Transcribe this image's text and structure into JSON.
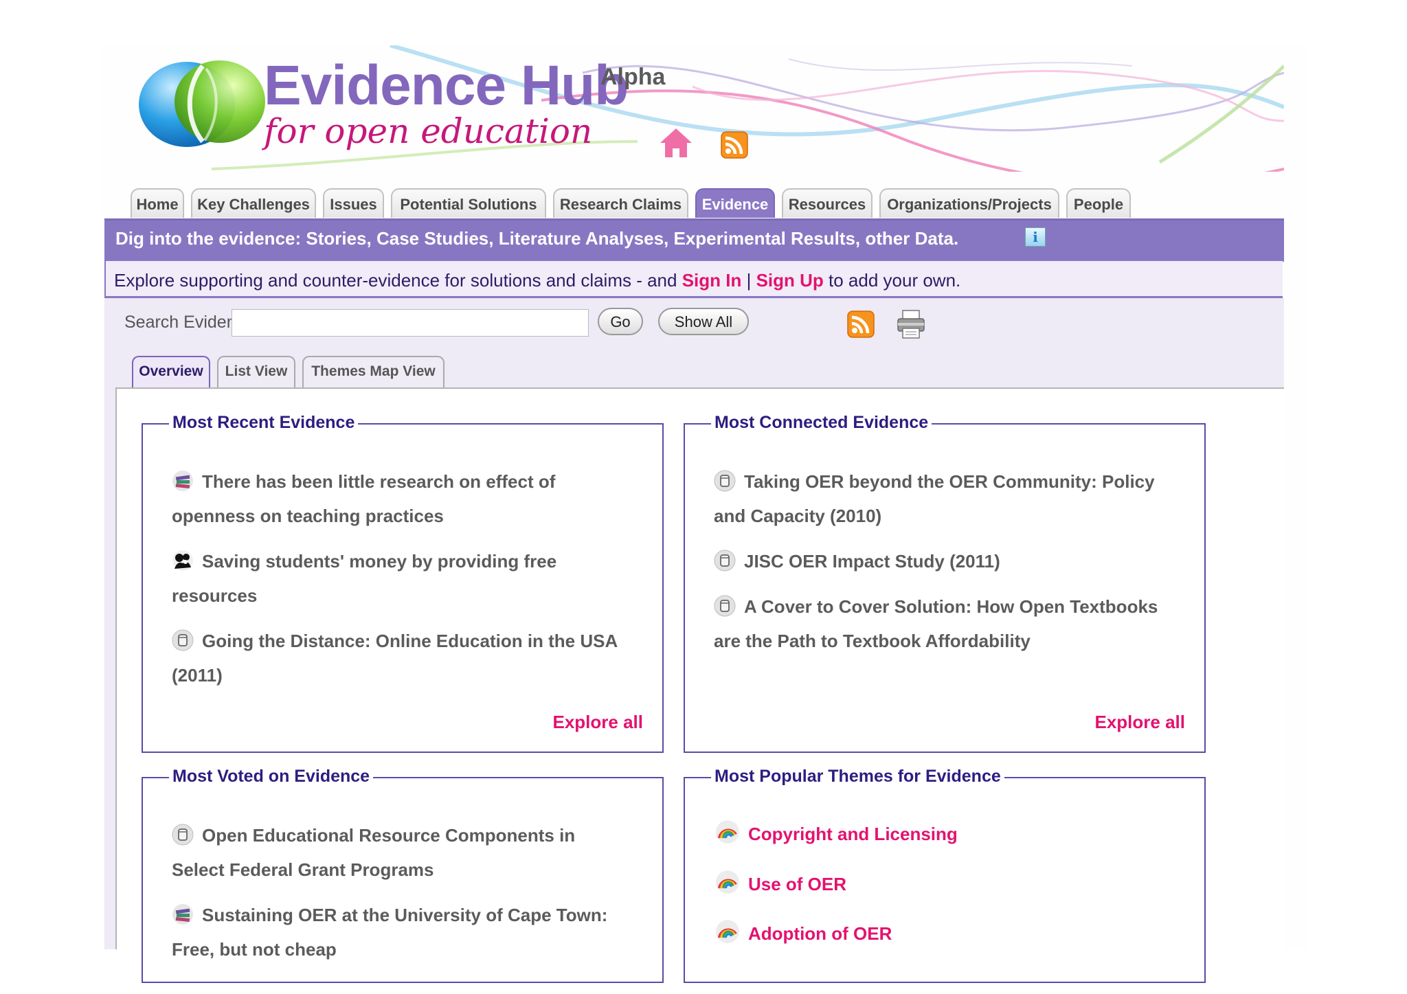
{
  "header": {
    "logo_title": "Evidence Hub",
    "logo_subtitle": "for open education",
    "badge": "Alpha",
    "home_icon": "home-icon",
    "rss_icon": "rss-icon"
  },
  "nav": {
    "tabs": [
      {
        "label": "Home",
        "active": false
      },
      {
        "label": "Key Challenges",
        "active": false
      },
      {
        "label": "Issues",
        "active": false
      },
      {
        "label": "Potential Solutions",
        "active": false
      },
      {
        "label": "Research Claims",
        "active": false
      },
      {
        "label": "Evidence",
        "active": true
      },
      {
        "label": "Resources",
        "active": false
      },
      {
        "label": "Organizations/Projects",
        "active": false
      },
      {
        "label": "People",
        "active": false
      }
    ]
  },
  "banner": {
    "heading": "Dig into the evidence: Stories, Case Studies, Literature Analyses, Experimental Results, other Data.",
    "info_icon_glyph": "i",
    "intro_before": "Explore supporting and counter-evidence for solutions and claims - and ",
    "sign_in": "Sign In",
    "separator": " | ",
    "sign_up": "Sign Up",
    "intro_after": " to add your own."
  },
  "search": {
    "label": "Search Evidence",
    "value": "",
    "go_label": "Go",
    "show_all_label": "Show All"
  },
  "view_tabs": [
    {
      "label": "Overview",
      "active": true
    },
    {
      "label": "List View",
      "active": false
    },
    {
      "label": "Themes Map View",
      "active": false
    }
  ],
  "panels": {
    "recent": {
      "title": "Most Recent Evidence",
      "items": [
        {
          "icon": "books-icon",
          "text": "There has been little research on effect of openness on teaching practices"
        },
        {
          "icon": "people-icon",
          "text": "Saving students' money by providing free resources"
        },
        {
          "icon": "database-icon",
          "text": "Going the Distance: Online Education in the USA (2011)"
        }
      ],
      "explore_all": "Explore all"
    },
    "connected": {
      "title": "Most Connected Evidence",
      "items": [
        {
          "icon": "database-icon",
          "text": "Taking OER beyond the OER Community: Policy and Capacity (2010)"
        },
        {
          "icon": "database-icon",
          "text": "JISC OER Impact Study (2011)"
        },
        {
          "icon": "database-icon",
          "text": "A Cover to Cover Solution: How Open Textbooks are the Path to Textbook Affordability"
        }
      ],
      "explore_all": "Explore all"
    },
    "voted": {
      "title": "Most Voted on Evidence",
      "items": [
        {
          "icon": "database-icon",
          "text": "Open Educational Resource Components in Select Federal Grant Programs"
        },
        {
          "icon": "books-icon",
          "text": "Sustaining OER at the University of Cape Town: Free, but not cheap"
        }
      ]
    },
    "themes": {
      "title": "Most Popular Themes for Evidence",
      "items": [
        {
          "icon": "rainbow-icon",
          "text": "Copyright and Licensing"
        },
        {
          "icon": "rainbow-icon",
          "text": "Use of OER"
        },
        {
          "icon": "rainbow-icon",
          "text": "Adoption of OER"
        }
      ]
    }
  },
  "colors": {
    "brand_purple": "#8777c3",
    "link_pink": "#e3126f",
    "title_navy": "#2d1d80",
    "logo_purple": "#8367bd",
    "logo_magenta": "#c6187b"
  }
}
